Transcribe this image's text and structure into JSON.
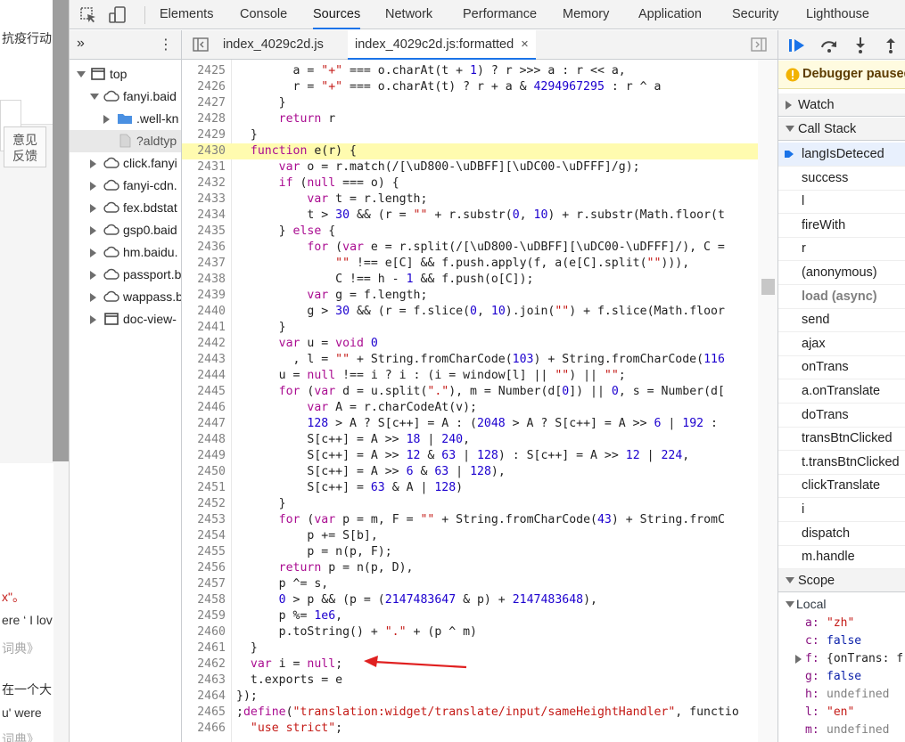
{
  "page_strip": {
    "top_text": "抗疫行动",
    "button_text": [
      "意见",
      "反馈"
    ],
    "texts": [
      "x\"。",
      "ere ‘ I lov",
      "词典》",
      "在一个大",
      "u' were",
      "词典》"
    ]
  },
  "toolbar": {
    "tabs": [
      "Elements",
      "Console",
      "Sources",
      "Network",
      "Performance",
      "Memory",
      "Application",
      "Security",
      "Lighthouse"
    ],
    "active_tab": "Sources"
  },
  "navigator": {
    "more_label": "»",
    "kebab_label": "⋮",
    "items": [
      {
        "label": "top",
        "icon": "frame-icon",
        "expanded": true,
        "indent": 0
      },
      {
        "label": "fanyi.baid",
        "icon": "cloud-icon",
        "expanded": true,
        "indent": 1
      },
      {
        "label": ".well-kn",
        "icon": "folder-icon",
        "expanded": false,
        "indent": 2
      },
      {
        "label": "?aldtyp",
        "icon": "file-icon",
        "expanded": null,
        "indent": 2
      },
      {
        "label": "click.fanyi",
        "icon": "cloud-icon",
        "expanded": false,
        "indent": 1
      },
      {
        "label": "fanyi-cdn.",
        "icon": "cloud-icon",
        "expanded": false,
        "indent": 1
      },
      {
        "label": "fex.bdstat",
        "icon": "cloud-icon",
        "expanded": false,
        "indent": 1
      },
      {
        "label": "gsp0.baid",
        "icon": "cloud-icon",
        "expanded": false,
        "indent": 1
      },
      {
        "label": "hm.baidu.",
        "icon": "cloud-icon",
        "expanded": false,
        "indent": 1
      },
      {
        "label": "passport.b",
        "icon": "cloud-icon",
        "expanded": false,
        "indent": 1
      },
      {
        "label": "wappass.b",
        "icon": "cloud-icon",
        "expanded": false,
        "indent": 1
      },
      {
        "label": "doc-view-",
        "icon": "frame-icon",
        "expanded": false,
        "indent": 1
      }
    ]
  },
  "editor": {
    "tabs": [
      {
        "label": "index_4029c2d.js",
        "active": false
      },
      {
        "label": "index_4029c2d.js:formatted",
        "active": true,
        "close": "×"
      }
    ],
    "highlighted_line": 2430,
    "lines": [
      {
        "n": "2425",
        "code": "        a = \"+\" === o.charAt(t + 1) ? r >>> a : r << a,"
      },
      {
        "n": "2426",
        "code": "        r = \"+\" === o.charAt(t) ? r + a & 4294967295 : r ^ a"
      },
      {
        "n": "2427",
        "code": "      }"
      },
      {
        "n": "2428",
        "code": "      return r"
      },
      {
        "n": "2429",
        "code": "  }"
      },
      {
        "n": "2430",
        "code": "  function e(r) {"
      },
      {
        "n": "2431",
        "code": "      var o = r.match(/[\\uD800-\\uDBFF][\\uDC00-\\uDFFF]/g);"
      },
      {
        "n": "2432",
        "code": "      if (null === o) {"
      },
      {
        "n": "2433",
        "code": "          var t = r.length;"
      },
      {
        "n": "2434",
        "code": "          t > 30 && (r = \"\" + r.substr(0, 10) + r.substr(Math.floor(t"
      },
      {
        "n": "2435",
        "code": "      } else {"
      },
      {
        "n": "2436",
        "code": "          for (var e = r.split(/[\\uD800-\\uDBFF][\\uDC00-\\uDFFF]/), C ="
      },
      {
        "n": "2437",
        "code": "              \"\" !== e[C] && f.push.apply(f, a(e[C].split(\"\"))),"
      },
      {
        "n": "2438",
        "code": "              C !== h - 1 && f.push(o[C]);"
      },
      {
        "n": "2439",
        "code": "          var g = f.length;"
      },
      {
        "n": "2440",
        "code": "          g > 30 && (r = f.slice(0, 10).join(\"\") + f.slice(Math.floor"
      },
      {
        "n": "2441",
        "code": "      }"
      },
      {
        "n": "2442",
        "code": "      var u = void 0"
      },
      {
        "n": "2443",
        "code": "        , l = \"\" + String.fromCharCode(103) + String.fromCharCode(116"
      },
      {
        "n": "2444",
        "code": "      u = null !== i ? i : (i = window[l] || \"\") || \"\";"
      },
      {
        "n": "2445",
        "code": "      for (var d = u.split(\".\"), m = Number(d[0]) || 0, s = Number(d["
      },
      {
        "n": "2446",
        "code": "          var A = r.charCodeAt(v);"
      },
      {
        "n": "2447",
        "code": "          128 > A ? S[c++] = A : (2048 > A ? S[c++] = A >> 6 | 192 :"
      },
      {
        "n": "2448",
        "code": "          S[c++] = A >> 18 | 240,"
      },
      {
        "n": "2449",
        "code": "          S[c++] = A >> 12 & 63 | 128) : S[c++] = A >> 12 | 224,"
      },
      {
        "n": "2450",
        "code": "          S[c++] = A >> 6 & 63 | 128),"
      },
      {
        "n": "2451",
        "code": "          S[c++] = 63 & A | 128)"
      },
      {
        "n": "2452",
        "code": "      }"
      },
      {
        "n": "2453",
        "code": "      for (var p = m, F = \"\" + String.fromCharCode(43) + String.fromC"
      },
      {
        "n": "2454",
        "code": "          p += S[b],"
      },
      {
        "n": "2455",
        "code": "          p = n(p, F);"
      },
      {
        "n": "2456",
        "code": "      return p = n(p, D),"
      },
      {
        "n": "2457",
        "code": "      p ^= s,"
      },
      {
        "n": "2458",
        "code": "      0 > p && (p = (2147483647 & p) + 2147483648),"
      },
      {
        "n": "2459",
        "code": "      p %= 1e6,"
      },
      {
        "n": "2460",
        "code": "      p.toString() + \".\" + (p ^ m)"
      },
      {
        "n": "2461",
        "code": "  }"
      },
      {
        "n": "2462",
        "code": "  var i = null;"
      },
      {
        "n": "2463",
        "code": "  t.exports = e"
      },
      {
        "n": "2464",
        "code": "});"
      },
      {
        "n": "2465",
        "code": ";define(\"translation:widget/translate/input/sameHeightHandler\", functio"
      },
      {
        "n": "2466",
        "code": "  \"use strict\";"
      }
    ]
  },
  "debugger": {
    "paused_text": "Debugger paused",
    "watch_label": "Watch",
    "callstack_label": "Call Stack",
    "frames": [
      "langIsDeteced",
      "success",
      "l",
      "fireWith",
      "r",
      "(anonymous)",
      "load (async)",
      "send",
      "ajax",
      "onTrans",
      "a.onTranslate",
      "doTrans",
      "transBtnClicked",
      "t.transBtnClicked",
      "clickTranslate",
      "i",
      "dispatch",
      "m.handle"
    ],
    "active_frame": "langIsDeteced",
    "scope_label": "Scope",
    "local_label": "Local",
    "locals": [
      {
        "k": "a",
        "v": "\"zh\"",
        "type": "str"
      },
      {
        "k": "c",
        "v": "false",
        "type": "kw"
      },
      {
        "k": "f",
        "v": "{onTrans: f",
        "type": "obj"
      },
      {
        "k": "g",
        "v": "false",
        "type": "kw"
      },
      {
        "k": "h",
        "v": "undefined",
        "type": "undef"
      },
      {
        "k": "l",
        "v": "\"en\"",
        "type": "str"
      },
      {
        "k": "m",
        "v": "undefined",
        "type": "undef"
      }
    ]
  },
  "colors": {
    "accent": "#1a73e8",
    "highlight_line": "#fffbaf",
    "arrow": "#e02020",
    "keyword": "#aa0d91",
    "string": "#c41a16",
    "number": "#1c00cf"
  }
}
